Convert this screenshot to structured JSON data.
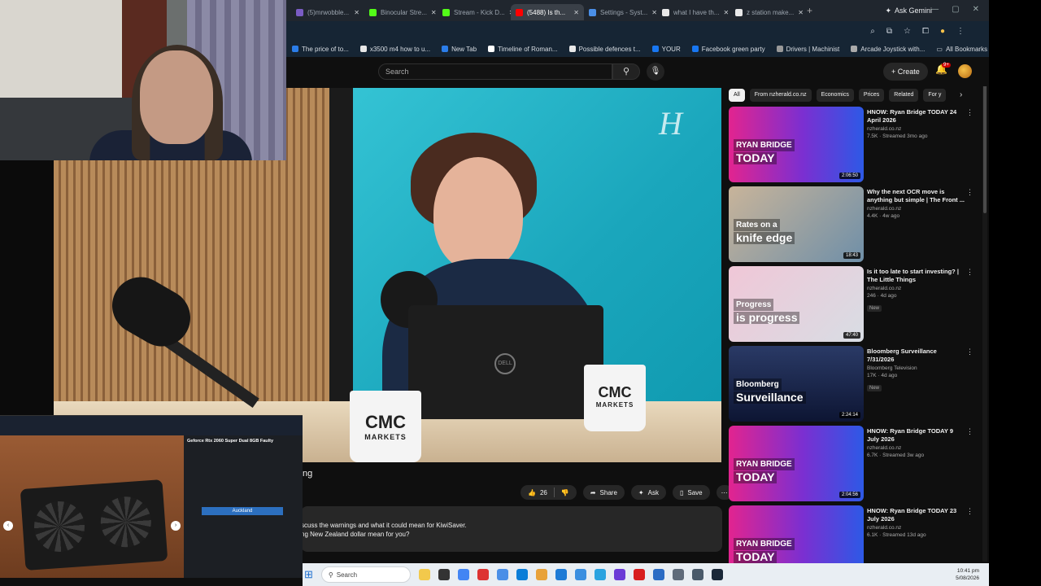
{
  "browser": {
    "tabs": [
      {
        "label": "(5)mrwobble...",
        "color": "#7a5cc4"
      },
      {
        "label": "Binocular Stre...",
        "color": "#53fc18"
      },
      {
        "label": "Stream - Kick D...",
        "color": "#53fc18"
      },
      {
        "label": "(5488) Is th...",
        "color": "#ff0000"
      },
      {
        "label": "Settings - Syst...",
        "color": "#4a8fe7"
      },
      {
        "label": "what I have th...",
        "color": "#e8e8e8"
      },
      {
        "label": "z station make...",
        "color": "#e8e8e8"
      }
    ],
    "ask_gemini": "Ask Gemini",
    "bookmarks": [
      {
        "label": "The price of to...",
        "color": "#2b7de9"
      },
      {
        "label": "x3500 m4 how to u...",
        "color": "#e8e8e8"
      },
      {
        "label": "New Tab",
        "color": "#2b7de9"
      },
      {
        "label": "Timeline of Roman...",
        "color": "#ffffff"
      },
      {
        "label": "Possible defences t...",
        "color": "#e8e8e8"
      },
      {
        "label": "YOUR",
        "color": "#1877f2"
      },
      {
        "label": "Facebook green party",
        "color": "#1877f2"
      },
      {
        "label": "Drivers | Machinist",
        "color": "#999999"
      },
      {
        "label": "Arcade Joystick with...",
        "color": "#aaaaaa"
      }
    ],
    "all_bookmarks": "All Bookmarks"
  },
  "yt": {
    "search_placeholder": "Search",
    "create_label": "Create",
    "notif_count": "9+",
    "title_fragment": "ng",
    "like_count": "26",
    "share_label": "Share",
    "ask_label": "Ask",
    "save_label": "Save",
    "desc_line1": "scuss the warnings and what it could mean for KiwiSaver.",
    "desc_line2": "ng New Zealand dollar mean for you?",
    "mug_text": "CMC",
    "mug_text2": "MARKETS",
    "laptop_logo": "DELL",
    "watermark": "H"
  },
  "chips": [
    "All",
    "From nzherald.co.nz",
    "Economics",
    "Prices",
    "Related",
    "For y"
  ],
  "recommendations": [
    {
      "title": "HNOW: Ryan Bridge TODAY 24 April 2026",
      "channel": "nzherald.co.nz",
      "stats": "7.5K · Streamed 3mo ago",
      "badge": "",
      "duration": "2:06:50",
      "thumb_line1": "RYAN BRIDGE",
      "thumb_line2": "TODAY",
      "thumb_bg": "linear-gradient(90deg,#e2248f,#7b2fd1 55%,#2d59e6)"
    },
    {
      "title": "Why the next OCR move is anything but simple | The Front ...",
      "channel": "nzherald.co.nz",
      "stats": "4.4K · 4w ago",
      "badge": "",
      "duration": "18:43",
      "thumb_line1": "Rates on a",
      "thumb_line2": "knife edge",
      "thumb_bg": "linear-gradient(135deg,#c8b49a,#6f8fa8)"
    },
    {
      "title": "Is it too late to start investing? | The Little Things",
      "channel": "nzherald.co.nz",
      "stats": "246 · 4d ago",
      "badge": "New",
      "duration": "47:40",
      "thumb_line1": "Progress",
      "thumb_line2": "is progress",
      "thumb_bg": "linear-gradient(135deg,#f0c7d7,#d8dde4)"
    },
    {
      "title": "Bloomberg Surveillance 7/31/2026",
      "channel": "Bloomberg Television",
      "stats": "17K · 4d ago",
      "badge": "New",
      "duration": "2:24:14",
      "thumb_line1": "Bloomberg",
      "thumb_line2": "Surveillance",
      "thumb_bg": "linear-gradient(180deg,#2a3a66,#0d1533)"
    },
    {
      "title": "HNOW: Ryan Bridge TODAY 9 July 2026",
      "channel": "nzherald.co.nz",
      "stats": "6.7K · Streamed 3w ago",
      "badge": "",
      "duration": "2:04:56",
      "thumb_line1": "RYAN BRIDGE",
      "thumb_line2": "TODAY",
      "thumb_bg": "linear-gradient(90deg,#e2248f,#7b2fd1 55%,#2d59e6)"
    },
    {
      "title": "HNOW: Ryan Bridge TODAY 23 July 2026",
      "channel": "nzherald.co.nz",
      "stats": "6.1K · Streamed 13d ago",
      "badge": "",
      "duration": "",
      "thumb_line1": "RYAN BRIDGE",
      "thumb_line2": "TODAY",
      "thumb_bg": "linear-gradient(90deg,#e2248f,#7b2fd1 55%,#2d59e6)"
    }
  ],
  "gpu_listing": {
    "title": "Geforce Rtx 2060 Super Dual 8GB Faulty",
    "location": "Auckland"
  },
  "taskbar": {
    "search_label": "Search",
    "time": "10:41 pm",
    "date": "5/08/2026",
    "icons": [
      "#f2c94c",
      "#333333",
      "#4285f4",
      "#d33",
      "#4a8fe7",
      "#0a7ed8",
      "#e8a23a",
      "#1e7bd6",
      "#3a8fe0",
      "#2aa3e0",
      "#6b3bd6",
      "#d81e1e",
      "#2b6cc4",
      "#5f6b7a",
      "#4a5a6a",
      "#1b2838"
    ]
  }
}
